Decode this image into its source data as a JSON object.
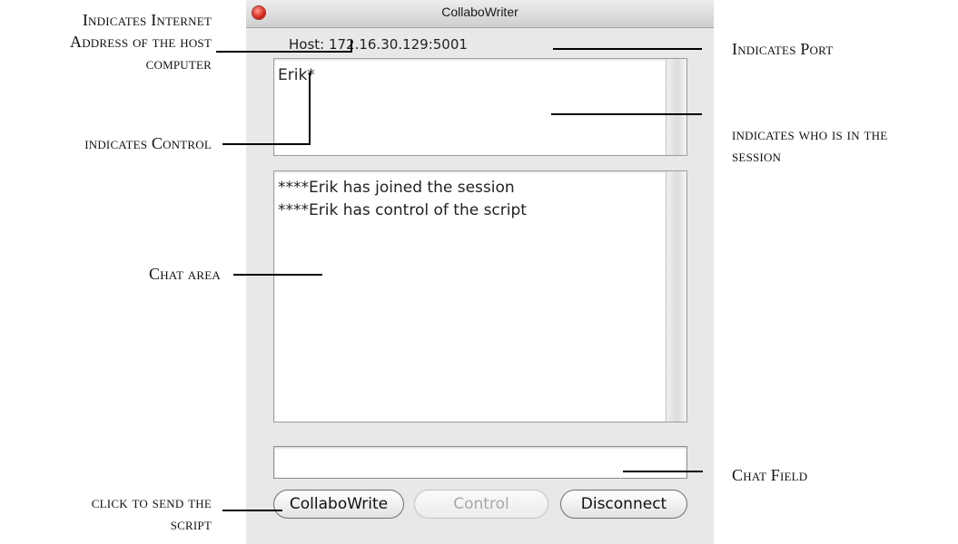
{
  "window": {
    "title": "CollaboWriter",
    "host_line": "Host: 172.16.30.129:5001",
    "participants_text": "Erik*",
    "chat_lines": [
      "****Erik has joined the session",
      "****Erik has control of the script"
    ],
    "chat_field_value": "",
    "buttons": {
      "collabowriter": "CollaboWrite",
      "control": "Control",
      "disconnect": "Disconnect"
    }
  },
  "annotations": {
    "internet_address": [
      "Indicates Internet",
      "Address of the host",
      "computer"
    ],
    "port": "Indicates Port",
    "who_in_session": [
      "indicates who is in the",
      "session"
    ],
    "control": "indicates Control",
    "chat_area": "Chat area",
    "chat_field": "Chat Field",
    "send_script": [
      "click to send the",
      "script"
    ]
  }
}
